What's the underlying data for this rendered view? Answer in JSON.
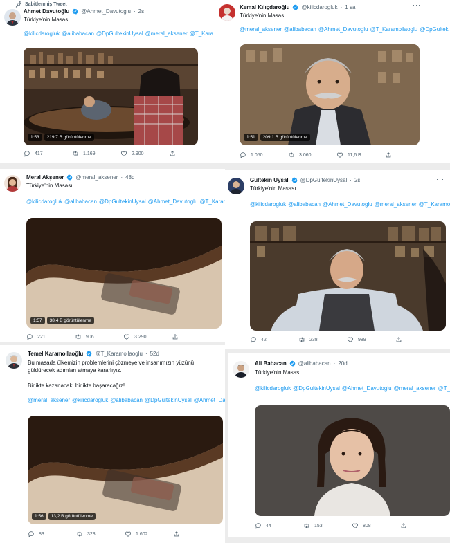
{
  "tweets": [
    {
      "pinned_label": "Sabitlenmiş Tweet",
      "name": "Ahmet Davutoğlu",
      "handle": "@Ahmet_Davutoglu",
      "time": "2s",
      "text": "Türkiye'nin Masası",
      "mentions": [
        "@kilicdarogluk",
        "@alibabacan",
        "@DpGultekinUysal",
        "@meral_aksener",
        "@T_Karamollaoglu"
      ],
      "video_duration": "1:53",
      "video_views": "219,7 B görüntülenme",
      "replies": "417",
      "retweets": "1.169",
      "likes": "2.900"
    },
    {
      "name": "Kemal Kılıçdaroğlu",
      "handle": "@kilicdarogluk",
      "time": "1 sa",
      "text": "Türkiye'nin Masası",
      "mentions": [
        "@meral_aksener",
        "@alibabacan",
        "@Ahmet_Davutoglu",
        "@T_Karamollaoglu",
        "@DpGultekinUysal"
      ],
      "video_duration": "1:51",
      "video_views": "209,1 B görüntülenme",
      "replies": "1.050",
      "retweets": "3.060",
      "likes": "11,6 B"
    },
    {
      "name": "Meral Akşener",
      "handle": "@meral_aksener",
      "time": "48d",
      "text": "Türkiye'nin Masası",
      "mentions": [
        "@kilicdarogluk",
        "@alibabacan",
        "@DpGultekinUysal",
        "@Ahmet_Davutoglu",
        "@T_Karamollaoglu"
      ],
      "video_duration": "1:57",
      "video_views": "38,4 B görüntülenme",
      "replies": "221",
      "retweets": "906",
      "likes": "3.290"
    },
    {
      "name": "Gültekin Uysal",
      "handle": "@DpGultekinUysal",
      "time": "2s",
      "text": "Türkiye'nin Masası",
      "mentions": [
        "@kilicdarogluk",
        "@alibabacan",
        "@Ahmet_Davutoglu",
        "@meral_aksener",
        "@T_Karamollaoglu"
      ],
      "replies": "42",
      "retweets": "238",
      "likes": "989"
    },
    {
      "name": "Temel Karamollaoğlu",
      "handle": "@T_Karamollaoglu",
      "time": "52d",
      "text_line1": "Bu masada ülkemizin problemlerini çözmeye ve insanımızın yüzünü",
      "text_line2": "güldürecek adımları atmaya kararlıyız.",
      "text_line3": "Birlikte kazanacak, birlikte başaracağız!",
      "mentions": [
        "@meral_aksener",
        "@kilicdarogluk",
        "@alibabacan",
        "@DpGultekinUysal",
        "@Ahmet_Davutoglu"
      ],
      "video_duration": "1:56",
      "video_views": "13,2 B görüntülenme",
      "replies": "83",
      "retweets": "323",
      "likes": "1.602"
    },
    {
      "name": "Ali Babacan",
      "handle": "@alibabacan",
      "time": "20d",
      "text": "Türkiye'nin Masası",
      "mentions": [
        "@kilicdarogluk",
        "@DpGultekinUysal",
        "@Ahmet_Davutoglu",
        "@meral_aksener",
        "@T_Karamollaoglu"
      ],
      "replies": "44",
      "retweets": "153",
      "likes": "808"
    }
  ],
  "icons": {
    "pin": "pin-icon",
    "verified": "verified-badge-icon",
    "more": "more-options-icon",
    "reply": "reply-icon",
    "retweet": "retweet-icon",
    "like": "like-icon",
    "share": "share-icon"
  },
  "colors": {
    "mention_blue": "#1d9bf0",
    "secondary_text": "#536471",
    "verified_blue": "#1d9bf0"
  }
}
